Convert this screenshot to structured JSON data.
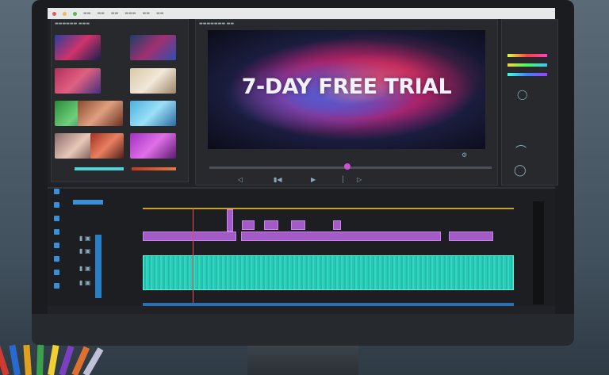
{
  "preview": {
    "title": "7-DAY FREE TRIAL"
  },
  "colors": {
    "video_clip": "#a35bc8",
    "audio_clip": "#2cd6c0",
    "accent": "#3b8fd6",
    "playhead": "#e05050",
    "ruler": "#c9a227"
  },
  "icons": [
    "play-icon",
    "step-back-icon",
    "step-forward-icon",
    "mark-in-icon",
    "mark-out-icon",
    "lock-icon",
    "eye-icon",
    "mute-icon",
    "pen-tool-icon",
    "razor-icon"
  ]
}
